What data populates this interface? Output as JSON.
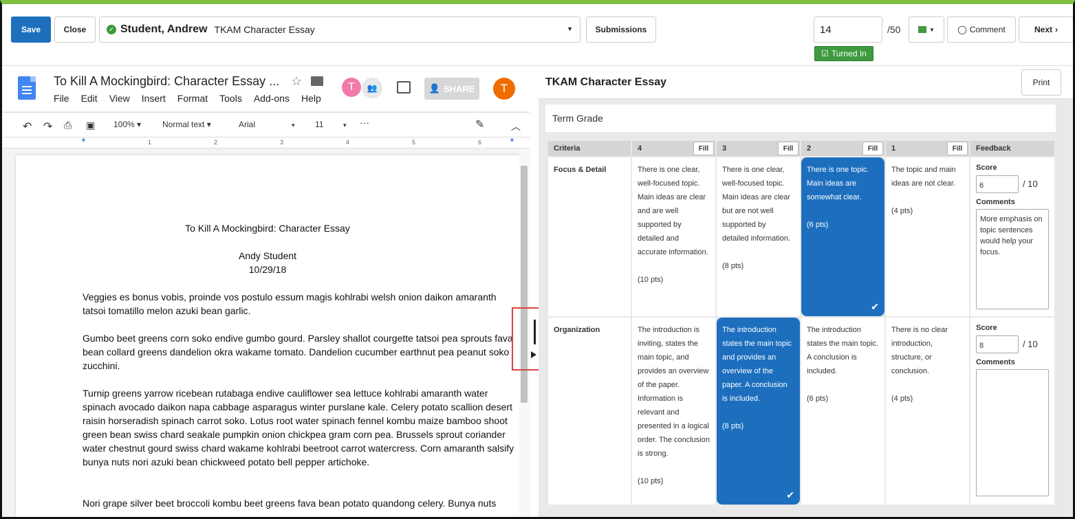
{
  "header": {
    "save_label": "Save",
    "close_label": "Close",
    "student_name": "Student, Andrew",
    "assignment_name": "TKAM Character Essay",
    "submissions_label": "Submissions",
    "score_value": "14",
    "score_out_of": "/50",
    "comment_label": "Comment",
    "next_label": "Next",
    "turned_in_label": "Turned In",
    "flag_color": "#3f9a3f"
  },
  "doc": {
    "title": "To Kill A Mockingbird: Character Essay ...",
    "menu": [
      "File",
      "Edit",
      "View",
      "Insert",
      "Format",
      "Tools",
      "Add-ons",
      "Help"
    ],
    "avatar1": "T",
    "avatar3": "T",
    "share_label": "SHARE",
    "toolbar": {
      "zoom": "100%",
      "style": "Normal text",
      "font": "Arial",
      "size": "11"
    },
    "ruler_marks": [
      "1",
      "2",
      "3",
      "4",
      "5",
      "6"
    ],
    "page_title": "To Kill A Mockingbird: Character Essay",
    "author": "Andy Student",
    "date": "10/29/18",
    "paragraphs": [
      "Veggies es bonus vobis, proinde vos postulo essum magis kohlrabi welsh onion daikon amaranth tatsoi tomatillo melon azuki bean garlic.",
      "Gumbo beet greens corn soko endive gumbo gourd. Parsley shallot courgette tatsoi pea sprouts fava bean collard greens dandelion okra wakame tomato. Dandelion cucumber earthnut pea peanut soko zucchini.",
      "Turnip greens yarrow ricebean rutabaga endive cauliflower sea lettuce kohlrabi amaranth water spinach avocado daikon napa cabbage asparagus winter purslane kale. Celery potato scallion desert raisin horseradish spinach carrot soko. Lotus root water spinach fennel kombu maize bamboo shoot green bean swiss chard seakale pumpkin onion chickpea gram corn pea. Brussels sprout coriander water chestnut gourd swiss chard wakame kohlrabi beetroot carrot watercress. Corn amaranth salsify bunya nuts nori azuki bean chickweed potato bell pepper artichoke.",
      "Nori grape silver beet broccoli kombu beet greens fava bean potato quandong celery. Bunya nuts"
    ]
  },
  "rubric": {
    "title": "TKAM Character Essay",
    "print_label": "Print",
    "term_grade_label": "Term Grade",
    "headers": {
      "criteria": "Criteria",
      "c4": "4",
      "c3": "3",
      "c2": "2",
      "c1": "1",
      "feedback": "Feedback",
      "fill": "Fill"
    },
    "rows": [
      {
        "name": "Focus & Detail",
        "cells": [
          "There is one clear, well-focused topic. Main ideas are clear and are well supported by detailed and accurate information.",
          "There is one clear, well-focused topic. Main ideas are clear but are not well supported by detailed information.",
          "There is one topic. Main ideas are somewhat clear.",
          "The topic and main ideas are not clear."
        ],
        "points": [
          "(10 pts)",
          "(8 pts)",
          "(6 pts)",
          "(4 pts)"
        ],
        "score_label": "Score",
        "score": "6",
        "out_of": "/ 10",
        "comments_label": "Comments",
        "comment": "More emphasis on topic sentences would help your focus."
      },
      {
        "name": "Organization",
        "cells": [
          "The introduction is inviting, states the main topic, and provides an overview of the paper. Information is relevant and presented in a logical order. The conclusion is strong.",
          "The introduction states the main topic and provides an overview of the paper. A conclusion is included.",
          "The introduction states the main topic. A conclusion is included.",
          "There is no clear introduction, structure, or conclusion."
        ],
        "points": [
          "(10 pts)",
          "(8 pts)",
          "(6 pts)",
          "(4 pts)"
        ],
        "score_label": "Score",
        "score": "8",
        "out_of": "/ 10",
        "comments_label": "Comments",
        "comment": ""
      }
    ]
  }
}
